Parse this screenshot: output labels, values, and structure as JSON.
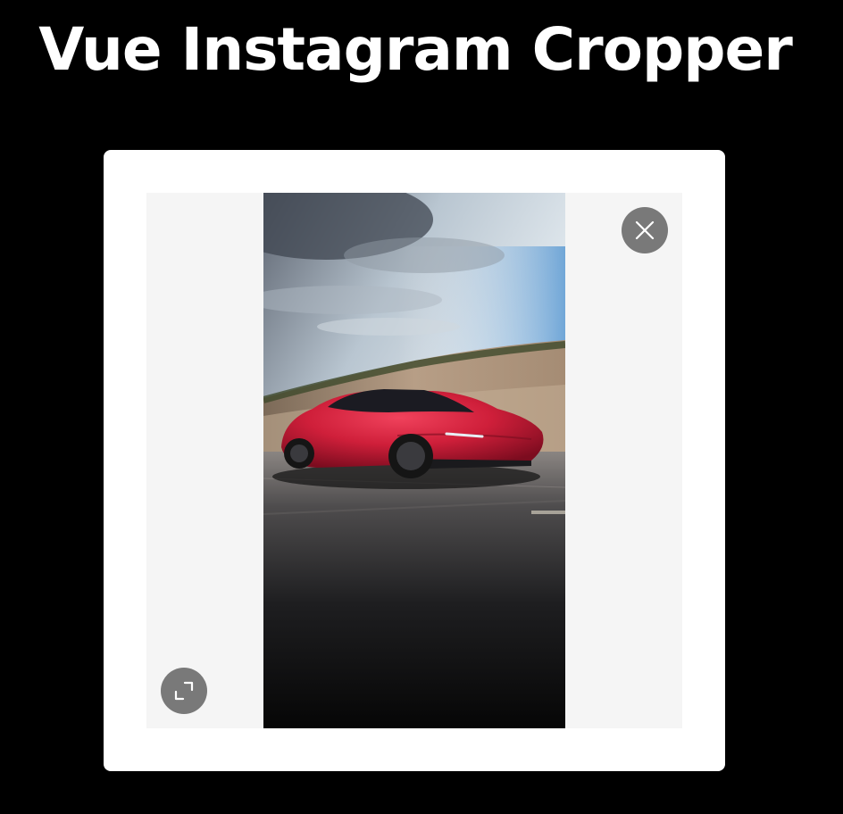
{
  "header": {
    "title": "Vue Instagram Cropper"
  },
  "cropper": {
    "image_alt": "Red sports car driving on a road",
    "remove_icon": "close-icon",
    "expand_icon": "expand-icon",
    "colors": {
      "background": "#000000",
      "card": "#ffffff",
      "crop_area": "#f5f5f5",
      "button": "#6e6e6e"
    }
  }
}
